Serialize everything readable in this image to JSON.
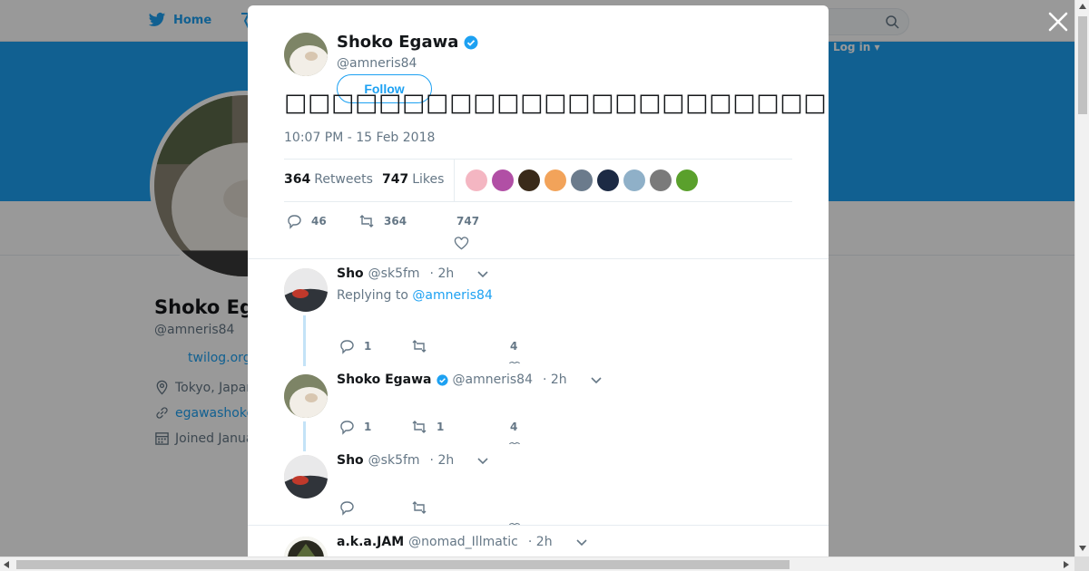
{
  "nav": {
    "home_label": "Home",
    "login_label": "Log in ▾"
  },
  "profile": {
    "name": "Shoko Eg",
    "handle": "@amneris84",
    "link": "twilog.org",
    "location": "Tokyo, Japan",
    "url": "egawashoko",
    "joined": "Joined Janua"
  },
  "tweet": {
    "author_name": "Shoko Egawa",
    "author_handle": "@amneris84",
    "follow_label": "Follow",
    "text": "□□□□□□□□□□□□□□□□□□□□□□□□□□□□□□□□□□□□□ □□□□□□□□□□□□□□□□□□□□□□□",
    "time": "10:07 PM - 15 Feb 2018",
    "retweets_count": "364",
    "retweets_label": "Retweets",
    "likes_count": "747",
    "likes_label": "Likes",
    "reply_count": "46",
    "retweet_count": "364",
    "like_count": "747",
    "liker_colors": [
      "#f4b6c2",
      "#b14fa5",
      "#3a2a1a",
      "#f2a35a",
      "#6b7b8c",
      "#1c2a44",
      "#8fb0c8",
      "#7a7a7a",
      "#5aa02c"
    ]
  },
  "replies": [
    {
      "name": "Sho",
      "handle": "@sk5fm",
      "time": "· 2h",
      "replying_prefix": "Replying to",
      "replying_to": "@amneris84",
      "reply_count": "1",
      "retweet_count": "",
      "like_count": "4"
    },
    {
      "name": "Shoko Egawa",
      "handle": "@amneris84",
      "time": "· 2h",
      "reply_count": "1",
      "retweet_count": "1",
      "like_count": "4"
    },
    {
      "name": "Sho",
      "handle": "@sk5fm",
      "time": "· 2h",
      "reply_count": "",
      "retweet_count": "",
      "like_count": ""
    },
    {
      "name": "a.k.a.JAM",
      "handle": "@nomad_Illmatic",
      "time": "· 2h"
    }
  ],
  "colors": {
    "brand": "#1da1f2",
    "text": "#14171a",
    "muted": "#657786"
  }
}
